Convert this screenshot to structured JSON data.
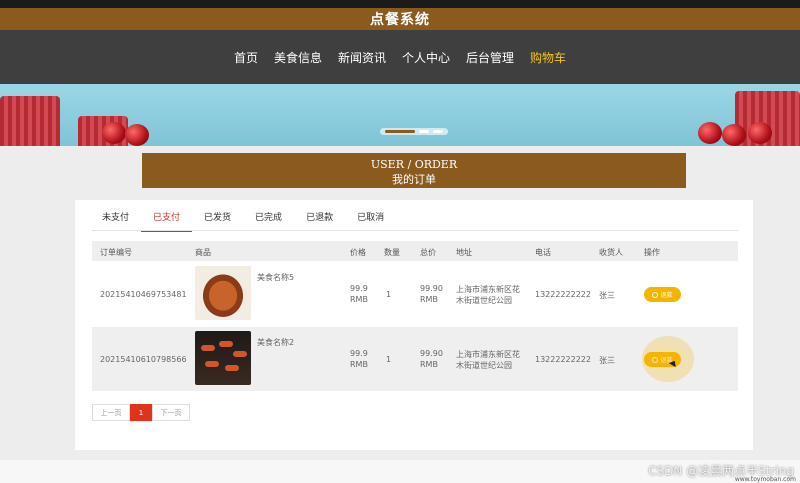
{
  "app": {
    "title": "点餐系统"
  },
  "nav": {
    "items": [
      {
        "label": "首页"
      },
      {
        "label": "美食信息"
      },
      {
        "label": "新闻资讯"
      },
      {
        "label": "个人中心"
      },
      {
        "label": "后台管理"
      },
      {
        "label": "购物车"
      }
    ],
    "active_index": 5
  },
  "order_heading": {
    "en": "USER / ORDER",
    "cn": "我的订单"
  },
  "tabs": [
    {
      "label": "未支付"
    },
    {
      "label": "已支付"
    },
    {
      "label": "已发货"
    },
    {
      "label": "已完成"
    },
    {
      "label": "已退款"
    },
    {
      "label": "已取消"
    }
  ],
  "active_tab": 1,
  "table": {
    "headers": [
      "订单编号",
      "商品",
      "价格",
      "数量",
      "总价",
      "地址",
      "电话",
      "收货人",
      "操作"
    ],
    "rows": [
      {
        "order_no": "20215410469753481",
        "product": "美食名称5",
        "price": "99.9",
        "price_unit": "RMB",
        "qty": "1",
        "total": "99.90",
        "total_unit": "RMB",
        "address_line1": "上海市浦东新区花",
        "address_line2": "木街道世纪公园",
        "phone": "13222222222",
        "receiver": "张三",
        "action": "退款"
      },
      {
        "order_no": "20215410610798566",
        "product": "美食名称2",
        "price": "99.9",
        "price_unit": "RMB",
        "qty": "1",
        "total": "99.90",
        "total_unit": "RMB",
        "address_line1": "上海市浦东新区花",
        "address_line2": "木街道世纪公园",
        "phone": "13222222222",
        "receiver": "张三",
        "action": "退款"
      }
    ]
  },
  "pager": {
    "prev": "上一页",
    "current": "1",
    "next": "下一页"
  },
  "watermark": {
    "text": "CSDN @凌晨两点半String",
    "sub": "www.toymoban.com"
  },
  "colors": {
    "brand": "#8a5a1e",
    "nav_bg": "#3f3f3f",
    "accent": "#f5c518",
    "button": "#f5b400",
    "active_tab": "#c0392b",
    "page_current": "#e0321d"
  }
}
